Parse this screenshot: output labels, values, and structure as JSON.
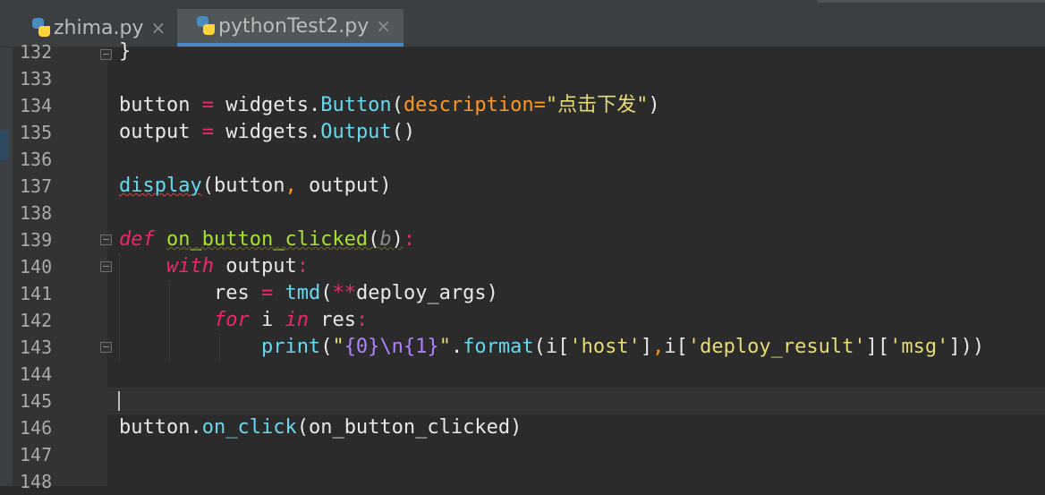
{
  "tabs": [
    {
      "label": "zhima.py",
      "close": "×",
      "active": false
    },
    {
      "label": "pythonTest2.py",
      "close": "×",
      "active": true
    }
  ],
  "gutter": {
    "line_numbers": [
      "132",
      "133",
      "134",
      "135",
      "136",
      "137",
      "138",
      "139",
      "140",
      "141",
      "142",
      "143",
      "144",
      "145",
      "146",
      "147",
      "148"
    ]
  },
  "code": {
    "l132": {
      "brace": "}"
    },
    "l134": {
      "var": "button",
      "eq": "=",
      "obj": "widgets",
      "dot": ".",
      "cls": "Button",
      "open": "(",
      "kw": "description",
      "eqs": "=",
      "str": "\"点击下发\"",
      "close": ")"
    },
    "l135": {
      "var": "output",
      "eq": "=",
      "obj": "widgets",
      "dot": ".",
      "cls": "Output",
      "parens": "()"
    },
    "l137": {
      "fn": "display",
      "open": "(",
      "a1": "button",
      "comma": ",",
      "a2": " output",
      "close": ")"
    },
    "l139": {
      "kw": "def",
      "name": "on_button_clicked",
      "open": "(",
      "param": "b",
      "close": ")",
      "colon": ":"
    },
    "l140": {
      "kw": "with",
      "name": "output",
      "colon": ":"
    },
    "l141": {
      "var": "res",
      "eq": "=",
      "fn": "tmd",
      "open": "(",
      "stars": "**",
      "arg": "deploy_args",
      "close": ")"
    },
    "l142": {
      "kw_for": "for",
      "var": "i",
      "kw_in": "in",
      "iter": "res",
      "colon": ":"
    },
    "l143": {
      "fn": "print",
      "open": "(",
      "s1": "\"",
      "b0": "{0}",
      "esc": "\\n",
      "b1": "{1}",
      "s2": "\"",
      "dot": ".",
      "method": "format",
      "open2": "(i[",
      "k1": "'host'",
      "mid1": "]",
      "comma": ",",
      "mid2": "i[",
      "k2": "'deploy_result'",
      "mid3": "][",
      "k3": "'msg'",
      "close": "]))"
    },
    "l146": {
      "obj": "button",
      "dot": ".",
      "method": "on_click",
      "open": "(",
      "arg": "on_button_clicked",
      "close": ")"
    }
  }
}
